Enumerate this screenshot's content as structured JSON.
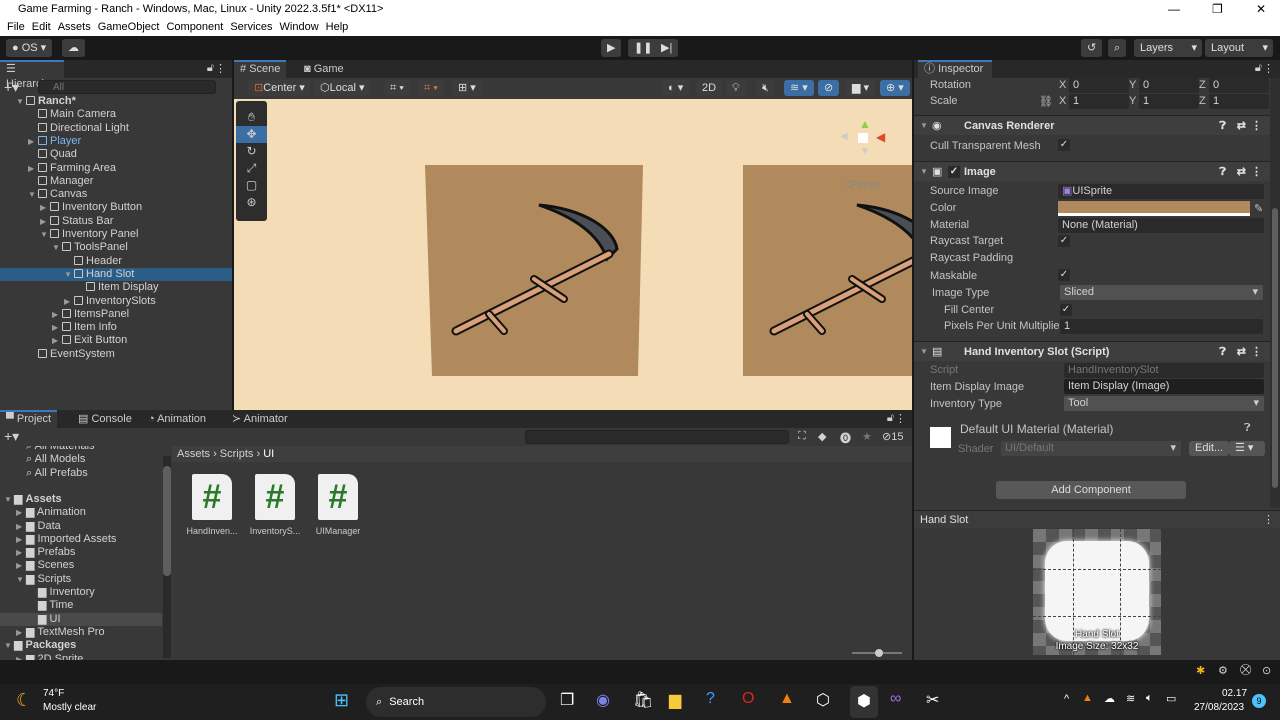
{
  "window": {
    "title": "Game Farming - Ranch - Windows, Mac, Linux - Unity 2022.3.5f1* <DX11>"
  },
  "menu": [
    "File",
    "Edit",
    "Assets",
    "GameObject",
    "Component",
    "Services",
    "Window",
    "Help"
  ],
  "toolbar": {
    "account": "OS",
    "layers": "Layers",
    "layout": "Layout"
  },
  "hierarchy": {
    "tab": "Hierarchy",
    "search_placeholder": "All",
    "items": [
      {
        "label": "Ranch*",
        "depth": 0,
        "arrow": "▼",
        "bold": true
      },
      {
        "label": "Main Camera",
        "depth": 1
      },
      {
        "label": "Directional Light",
        "depth": 1
      },
      {
        "label": "Player",
        "depth": 1,
        "arrow": "▶",
        "prefab": true
      },
      {
        "label": "Quad",
        "depth": 1
      },
      {
        "label": "Farming Area",
        "depth": 1,
        "arrow": "▶"
      },
      {
        "label": "Manager",
        "depth": 1
      },
      {
        "label": "Canvas",
        "depth": 1,
        "arrow": "▼"
      },
      {
        "label": "Inventory Button",
        "depth": 2,
        "arrow": "▶"
      },
      {
        "label": "Status Bar",
        "depth": 2,
        "arrow": "▶"
      },
      {
        "label": "Inventory Panel",
        "depth": 2,
        "arrow": "▼"
      },
      {
        "label": "ToolsPanel",
        "depth": 3,
        "arrow": "▼"
      },
      {
        "label": "Header",
        "depth": 4
      },
      {
        "label": "Hand Slot",
        "depth": 4,
        "arrow": "▼",
        "selected": true
      },
      {
        "label": "Item Display",
        "depth": 5
      },
      {
        "label": "InventorySlots",
        "depth": 4,
        "arrow": "▶"
      },
      {
        "label": "ItemsPanel",
        "depth": 3,
        "arrow": "▶"
      },
      {
        "label": "Item Info",
        "depth": 3,
        "arrow": "▶"
      },
      {
        "label": "Exit Button",
        "depth": 3,
        "arrow": "▶"
      },
      {
        "label": "EventSystem",
        "depth": 1
      }
    ]
  },
  "scene": {
    "tabs": [
      "Scene",
      "Game"
    ],
    "pivot": "Center",
    "space": "Local",
    "mode_2d": "2D",
    "persp": "<Persp",
    "background": "#f3dcb6",
    "slot_color": "#b08a5c"
  },
  "project": {
    "tabs": [
      "Project",
      "Console",
      "Animation",
      "Animator"
    ],
    "hidden_count": "15",
    "favorites": [
      "All Materials",
      "All Models",
      "All Prefabs"
    ],
    "tree": [
      {
        "label": "Assets",
        "depth": 0,
        "bold": true,
        "arrow": "▼"
      },
      {
        "label": "Animation",
        "depth": 1,
        "arrow": "▶"
      },
      {
        "label": "Data",
        "depth": 1,
        "arrow": "▶"
      },
      {
        "label": "Imported Assets",
        "depth": 1,
        "arrow": "▶"
      },
      {
        "label": "Prefabs",
        "depth": 1,
        "arrow": "▶"
      },
      {
        "label": "Scenes",
        "depth": 1,
        "arrow": "▶"
      },
      {
        "label": "Scripts",
        "depth": 1,
        "arrow": "▼"
      },
      {
        "label": "Inventory",
        "depth": 2
      },
      {
        "label": "Time",
        "depth": 2
      },
      {
        "label": "UI",
        "depth": 2,
        "selected": true
      },
      {
        "label": "TextMesh Pro",
        "depth": 1,
        "arrow": "▶"
      },
      {
        "label": "Packages",
        "depth": 0,
        "bold": true,
        "arrow": "▼"
      },
      {
        "label": "2D Sprite",
        "depth": 1,
        "arrow": "▶"
      }
    ],
    "breadcrumb": [
      "Assets",
      "Scripts",
      "UI"
    ],
    "files": [
      "HandInven...",
      "InventoryS...",
      "UIManager"
    ]
  },
  "inspector": {
    "tab": "Inspector",
    "rotation": {
      "label": "Rotation",
      "x": "0",
      "y": "0",
      "z": "0"
    },
    "scale": {
      "label": "Scale",
      "x": "1",
      "y": "1",
      "z": "1"
    },
    "canvas_renderer": {
      "title": "Canvas Renderer",
      "cull_label": "Cull Transparent Mesh",
      "cull": true
    },
    "image": {
      "title": "Image",
      "source_label": "Source Image",
      "source": "UISprite",
      "color_label": "Color",
      "color": "#b08a5c",
      "material_label": "Material",
      "material": "None (Material)",
      "raycast_label": "Raycast Target",
      "raycast_padding": "Raycast Padding",
      "maskable_label": "Maskable",
      "type_label": "Image Type",
      "type": "Sliced",
      "fill_label": "Fill Center",
      "ppu_label": "Pixels Per Unit Multiplie",
      "ppu": "1"
    },
    "script": {
      "title": "Hand Inventory Slot (Script)",
      "script_label": "Script",
      "script": "HandInventorySlot",
      "item_label": "Item Display Image",
      "item": "Item Display (Image)",
      "inv_label": "Inventory Type",
      "inv": "Tool"
    },
    "material": {
      "title": "Default UI Material (Material)",
      "shader_label": "Shader",
      "shader": "UI/Default",
      "edit": "Edit..."
    },
    "add_component": "Add Component",
    "preview": {
      "title": "Hand Slot",
      "caption": "Hand Slot",
      "size": "Image Size: 32x32"
    }
  },
  "taskbar": {
    "temp": "74°F",
    "weather": "Mostly clear",
    "search": "Search",
    "time": "02.17",
    "date": "27/08/2023",
    "badge": "9"
  }
}
